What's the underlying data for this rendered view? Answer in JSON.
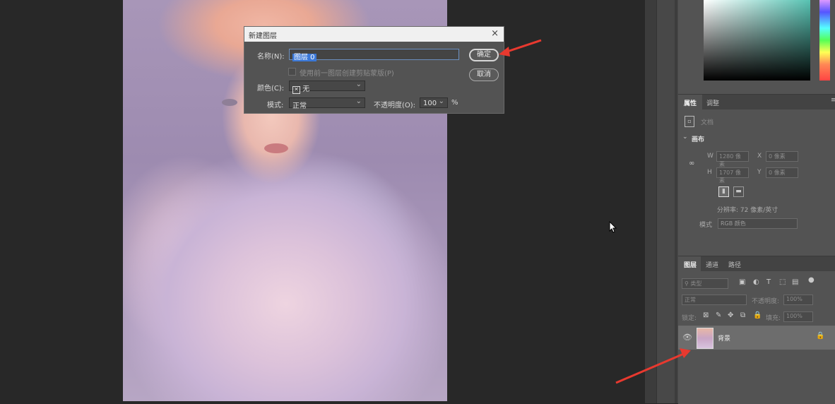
{
  "dialog": {
    "title": "新建图层",
    "close_glyph": "×",
    "name_label": "名称(N):",
    "name_value": "图层 0",
    "clip_label": "使用前一图层创建剪贴蒙版(P)",
    "color_label": "颜色(C):",
    "color_value": "无",
    "mode_label": "模式:",
    "mode_value": "正常",
    "opacity_label": "不透明度(O):",
    "opacity_value": "100",
    "percent": "%",
    "ok_label": "确定",
    "cancel_label": "取消"
  },
  "properties_panel": {
    "tabs": [
      "属性",
      "调整"
    ],
    "doc_label": "文档",
    "section": "画布",
    "w_label": "W",
    "w_value": "1280 像素",
    "h_label": "H",
    "h_value": "1707 像素",
    "x_label": "X",
    "x_value": "0 像素",
    "y_label": "Y",
    "y_value": "0 像素",
    "resolution": "分辨率: 72 像素/英寸",
    "mode_label": "模式",
    "mode_value": "RGB 颜色"
  },
  "layers_panel": {
    "tabs": [
      "图层",
      "通道",
      "路径"
    ],
    "filter_label": "类型",
    "blend_mode": "正常",
    "opacity_label": "不透明度:",
    "opacity_value": "100%",
    "lock_label": "锁定:",
    "fill_label": "填充:",
    "fill_value": "100%",
    "layers": [
      {
        "name": "背景",
        "visible": true,
        "locked": true
      }
    ]
  },
  "colors": {
    "annotation_arrow": "#e8392f",
    "selection": "#3b78d7"
  },
  "icons": {
    "eye": "eye-icon",
    "lock": "lock-icon",
    "close": "close-icon",
    "cursor": "mouse-cursor-icon"
  }
}
